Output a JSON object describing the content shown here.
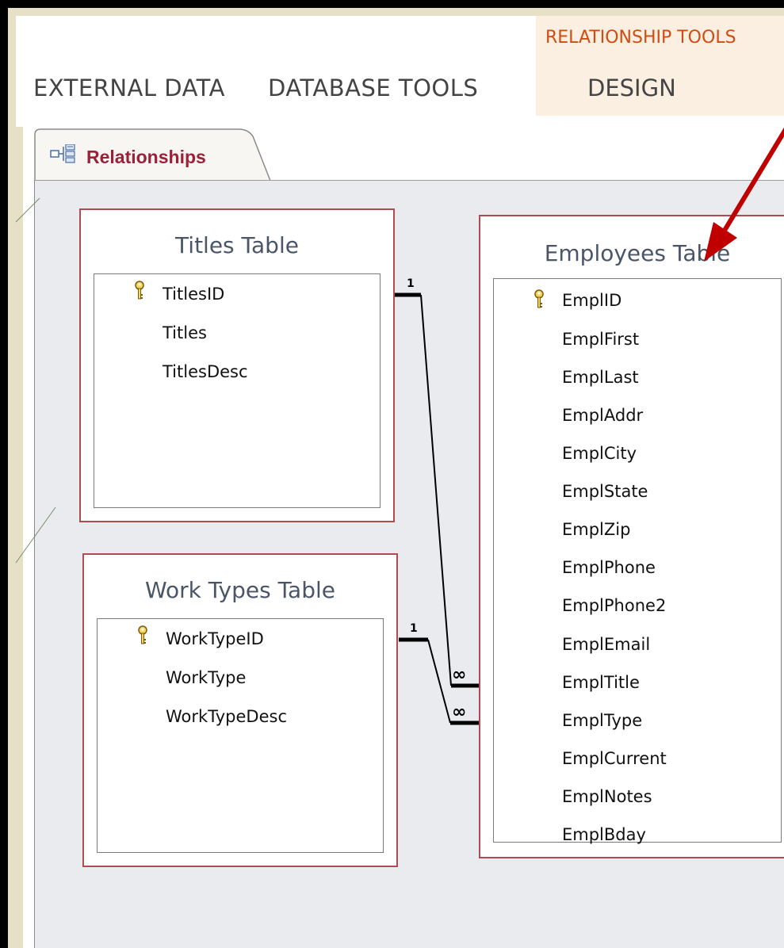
{
  "ribbon": {
    "tabs": [
      "EXTERNAL DATA",
      "DATABASE TOOLS"
    ],
    "contextual_group": "RELATIONSHIP TOOLS",
    "contextual_tab": "DESIGN"
  },
  "document_tab": {
    "label": "Relationships",
    "icon": "relationships-icon"
  },
  "tables": {
    "titles": {
      "title": "Titles Table",
      "fields": [
        "TitlesID",
        "Titles",
        "TitlesDesc"
      ],
      "primary_key": "TitlesID"
    },
    "work_types": {
      "title": "Work Types Table",
      "fields": [
        "WorkTypeID",
        "WorkType",
        "WorkTypeDesc"
      ],
      "primary_key": "WorkTypeID"
    },
    "employees": {
      "title": "Employees Table",
      "fields": [
        "EmplID",
        "EmplFirst",
        "EmplLast",
        "EmplAddr",
        "EmplCity",
        "EmplState",
        "EmplZip",
        "EmplPhone",
        "EmplPhone2",
        "EmplEmail",
        "EmplTitle",
        "EmplType",
        "EmplCurrent",
        "EmplNotes",
        "EmplBday"
      ],
      "primary_key": "EmplID"
    }
  },
  "relationships": [
    {
      "from": "TitlesID",
      "to": "EmplTitle",
      "one_label": "1",
      "many_label": "∞"
    },
    {
      "from": "WorkTypeID",
      "to": "EmplType",
      "one_label": "1",
      "many_label": "∞"
    }
  ],
  "colors": {
    "accent_contextual": "#d24b10",
    "table_border": "#b04b52",
    "doc_tab_text": "#9b2139",
    "arrow": "#c00000"
  }
}
